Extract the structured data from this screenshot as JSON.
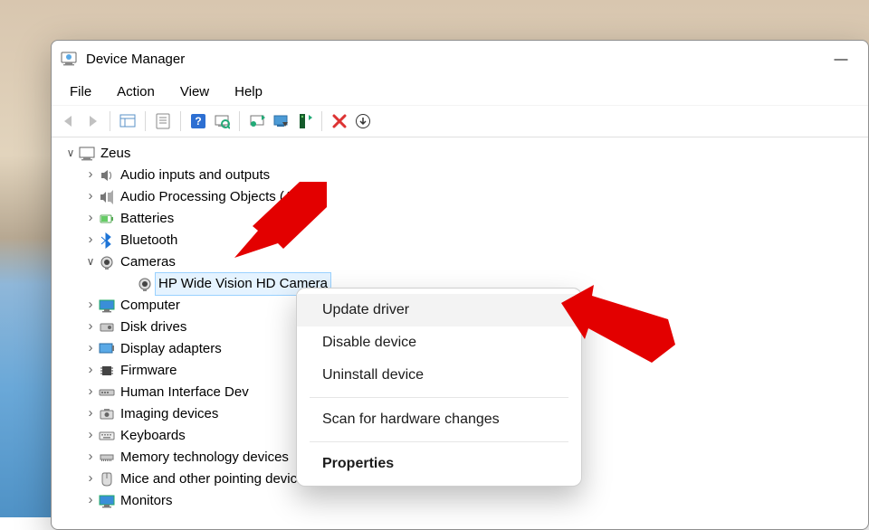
{
  "window": {
    "title": "Device Manager",
    "minimize_glyph": "—"
  },
  "menubar": [
    "File",
    "Action",
    "View",
    "Help"
  ],
  "root": {
    "name": "Zeus"
  },
  "nodes": [
    {
      "label": "Audio inputs and outputs",
      "icon": "speaker"
    },
    {
      "label": "Audio Processing Objects (APOs)",
      "icon": "speaker-stack"
    },
    {
      "label": "Batteries",
      "icon": "battery"
    },
    {
      "label": "Bluetooth",
      "icon": "bluetooth"
    },
    {
      "label": "Cameras",
      "icon": "camera",
      "expanded": true
    },
    {
      "label": "HP Wide Vision HD Camera",
      "icon": "camera",
      "level": 2,
      "selected": true,
      "leaf": true
    },
    {
      "label": "Computer",
      "icon": "monitor"
    },
    {
      "label": "Disk drives",
      "icon": "disk"
    },
    {
      "label": "Display adapters",
      "icon": "display-adapter"
    },
    {
      "label": "Firmware",
      "icon": "chip"
    },
    {
      "label": "Human Interface Dev",
      "icon": "hid"
    },
    {
      "label": "Imaging devices",
      "icon": "imaging"
    },
    {
      "label": "Keyboards",
      "icon": "keyboard"
    },
    {
      "label": "Memory technology devices",
      "icon": "memory"
    },
    {
      "label": "Mice and other pointing devices",
      "icon": "mouse"
    },
    {
      "label": "Monitors",
      "icon": "monitor"
    }
  ],
  "context_menu": {
    "update": "Update driver",
    "disable": "Disable device",
    "uninstall": "Uninstall device",
    "scan": "Scan for hardware changes",
    "properties": "Properties"
  }
}
